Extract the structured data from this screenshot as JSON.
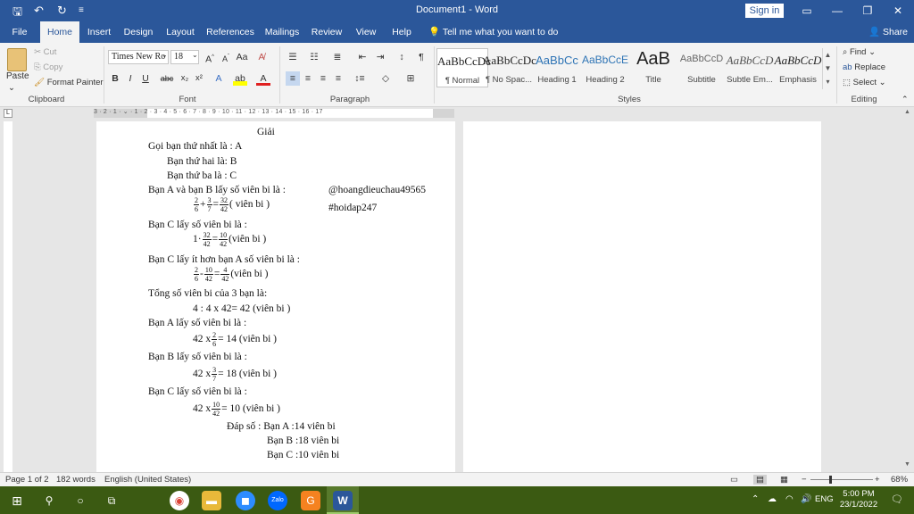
{
  "window": {
    "title": "Document1  -  Word",
    "sign_in": "Sign in",
    "title_bar_color": "#2b579a"
  },
  "tabs": [
    {
      "label": "File"
    },
    {
      "label": "Home"
    },
    {
      "label": "Insert"
    },
    {
      "label": "Design"
    },
    {
      "label": "Layout"
    },
    {
      "label": "References"
    },
    {
      "label": "Mailings"
    },
    {
      "label": "Review"
    },
    {
      "label": "View"
    },
    {
      "label": "Help"
    }
  ],
  "tell_me": "Tell me what you want to do",
  "share": "Share",
  "clipboard": {
    "paste": "Paste",
    "cut": "Cut",
    "copy": "Copy",
    "format_painter": "Format Painter",
    "label": "Clipboard"
  },
  "font": {
    "name": "Times New Ro",
    "size": "18",
    "label": "Font",
    "bold": "B",
    "italic": "I",
    "underline": "U",
    "strike": "abc",
    "sub": "x₂",
    "sup": "x²"
  },
  "paragraph": {
    "label": "Paragraph"
  },
  "styles": {
    "label": "Styles",
    "items": [
      {
        "preview": "AaBbCcDc",
        "name": "¶ Normal"
      },
      {
        "preview": "AaBbCcDc",
        "name": "¶ No Spac..."
      },
      {
        "preview": "AaBbCc",
        "name": "Heading 1"
      },
      {
        "preview": "AaBbCcE",
        "name": "Heading 2"
      },
      {
        "preview": "AaB",
        "name": "Title"
      },
      {
        "preview": "AaBbCcD",
        "name": "Subtitle"
      },
      {
        "preview": "AaBbCcD",
        "name": "Subtle Em..."
      },
      {
        "preview": "AaBbCcD",
        "name": "Emphasis"
      }
    ]
  },
  "editing": {
    "label": "Editing",
    "find": "Find",
    "replace": "Replace",
    "select": "Select"
  },
  "ruler_numbers": "3 · 2 · 1 · ⌄ · 1 · 2 · 3 · 4 · 5 · 6 · 7 · 8 · 9 · 10 · 11 · 12 · 13 · 14 · 15 · 16 · 17",
  "document": {
    "heading": "Giải",
    "l1": "Gọi bạn thứ nhất là : A",
    "l2": "Bạn thứ hai là: B",
    "l3": "Bạn thứ ba là : C",
    "l4": "Bạn A và bạn B lấy số viên bi là :",
    "handle": "@hoangdieuchau49565",
    "hashtag": "#hoidap247",
    "l5_result": "( viên bi )",
    "l6": "Bạn C lấy số viên bi là :",
    "l7_unit": "(viên bi )",
    "l8": "Bạn C lấy ít hơn bạn A số viên bi là :",
    "l9_unit": "(viên bi )",
    "l10": "Tổng số viên bi của 3 bạn là:",
    "l11": "4 : 4 x 42= 42 (viên bi )",
    "l12": "Bạn A lấy số viên bi là :",
    "l13_pre": "42 x",
    "l13_post": "= 14 (viên bi )",
    "l14": "Bạn B lấy số viên bi là :",
    "l15_pre": "42 x",
    "l15_post": "= 18 (viên bi )",
    "l16": "Bạn C lấy số viên bi là :",
    "l17_pre": "42 x",
    "l17_post": "= 10 (viên bi )",
    "l18": "Đáp số : Bạn A :14 viên bi",
    "l19": "Bạn B :18 viên bi",
    "l20": "Bạn C :10 viên bi",
    "f2": "2",
    "f6": "6",
    "f3": "3",
    "f7": "7",
    "f32": "32",
    "f42": "42",
    "f10": "10",
    "f4": "4",
    "one": "1",
    "plus": "+",
    "eq": "=",
    "dot": "·",
    "minus": "-"
  },
  "status": {
    "page": "Page 1 of 2",
    "words": "182 words",
    "language": "English (United States)",
    "zoom": "68%"
  },
  "taskbar": {
    "time": "5:00 PM",
    "date": "23/1/2022",
    "lang": "ENG"
  }
}
